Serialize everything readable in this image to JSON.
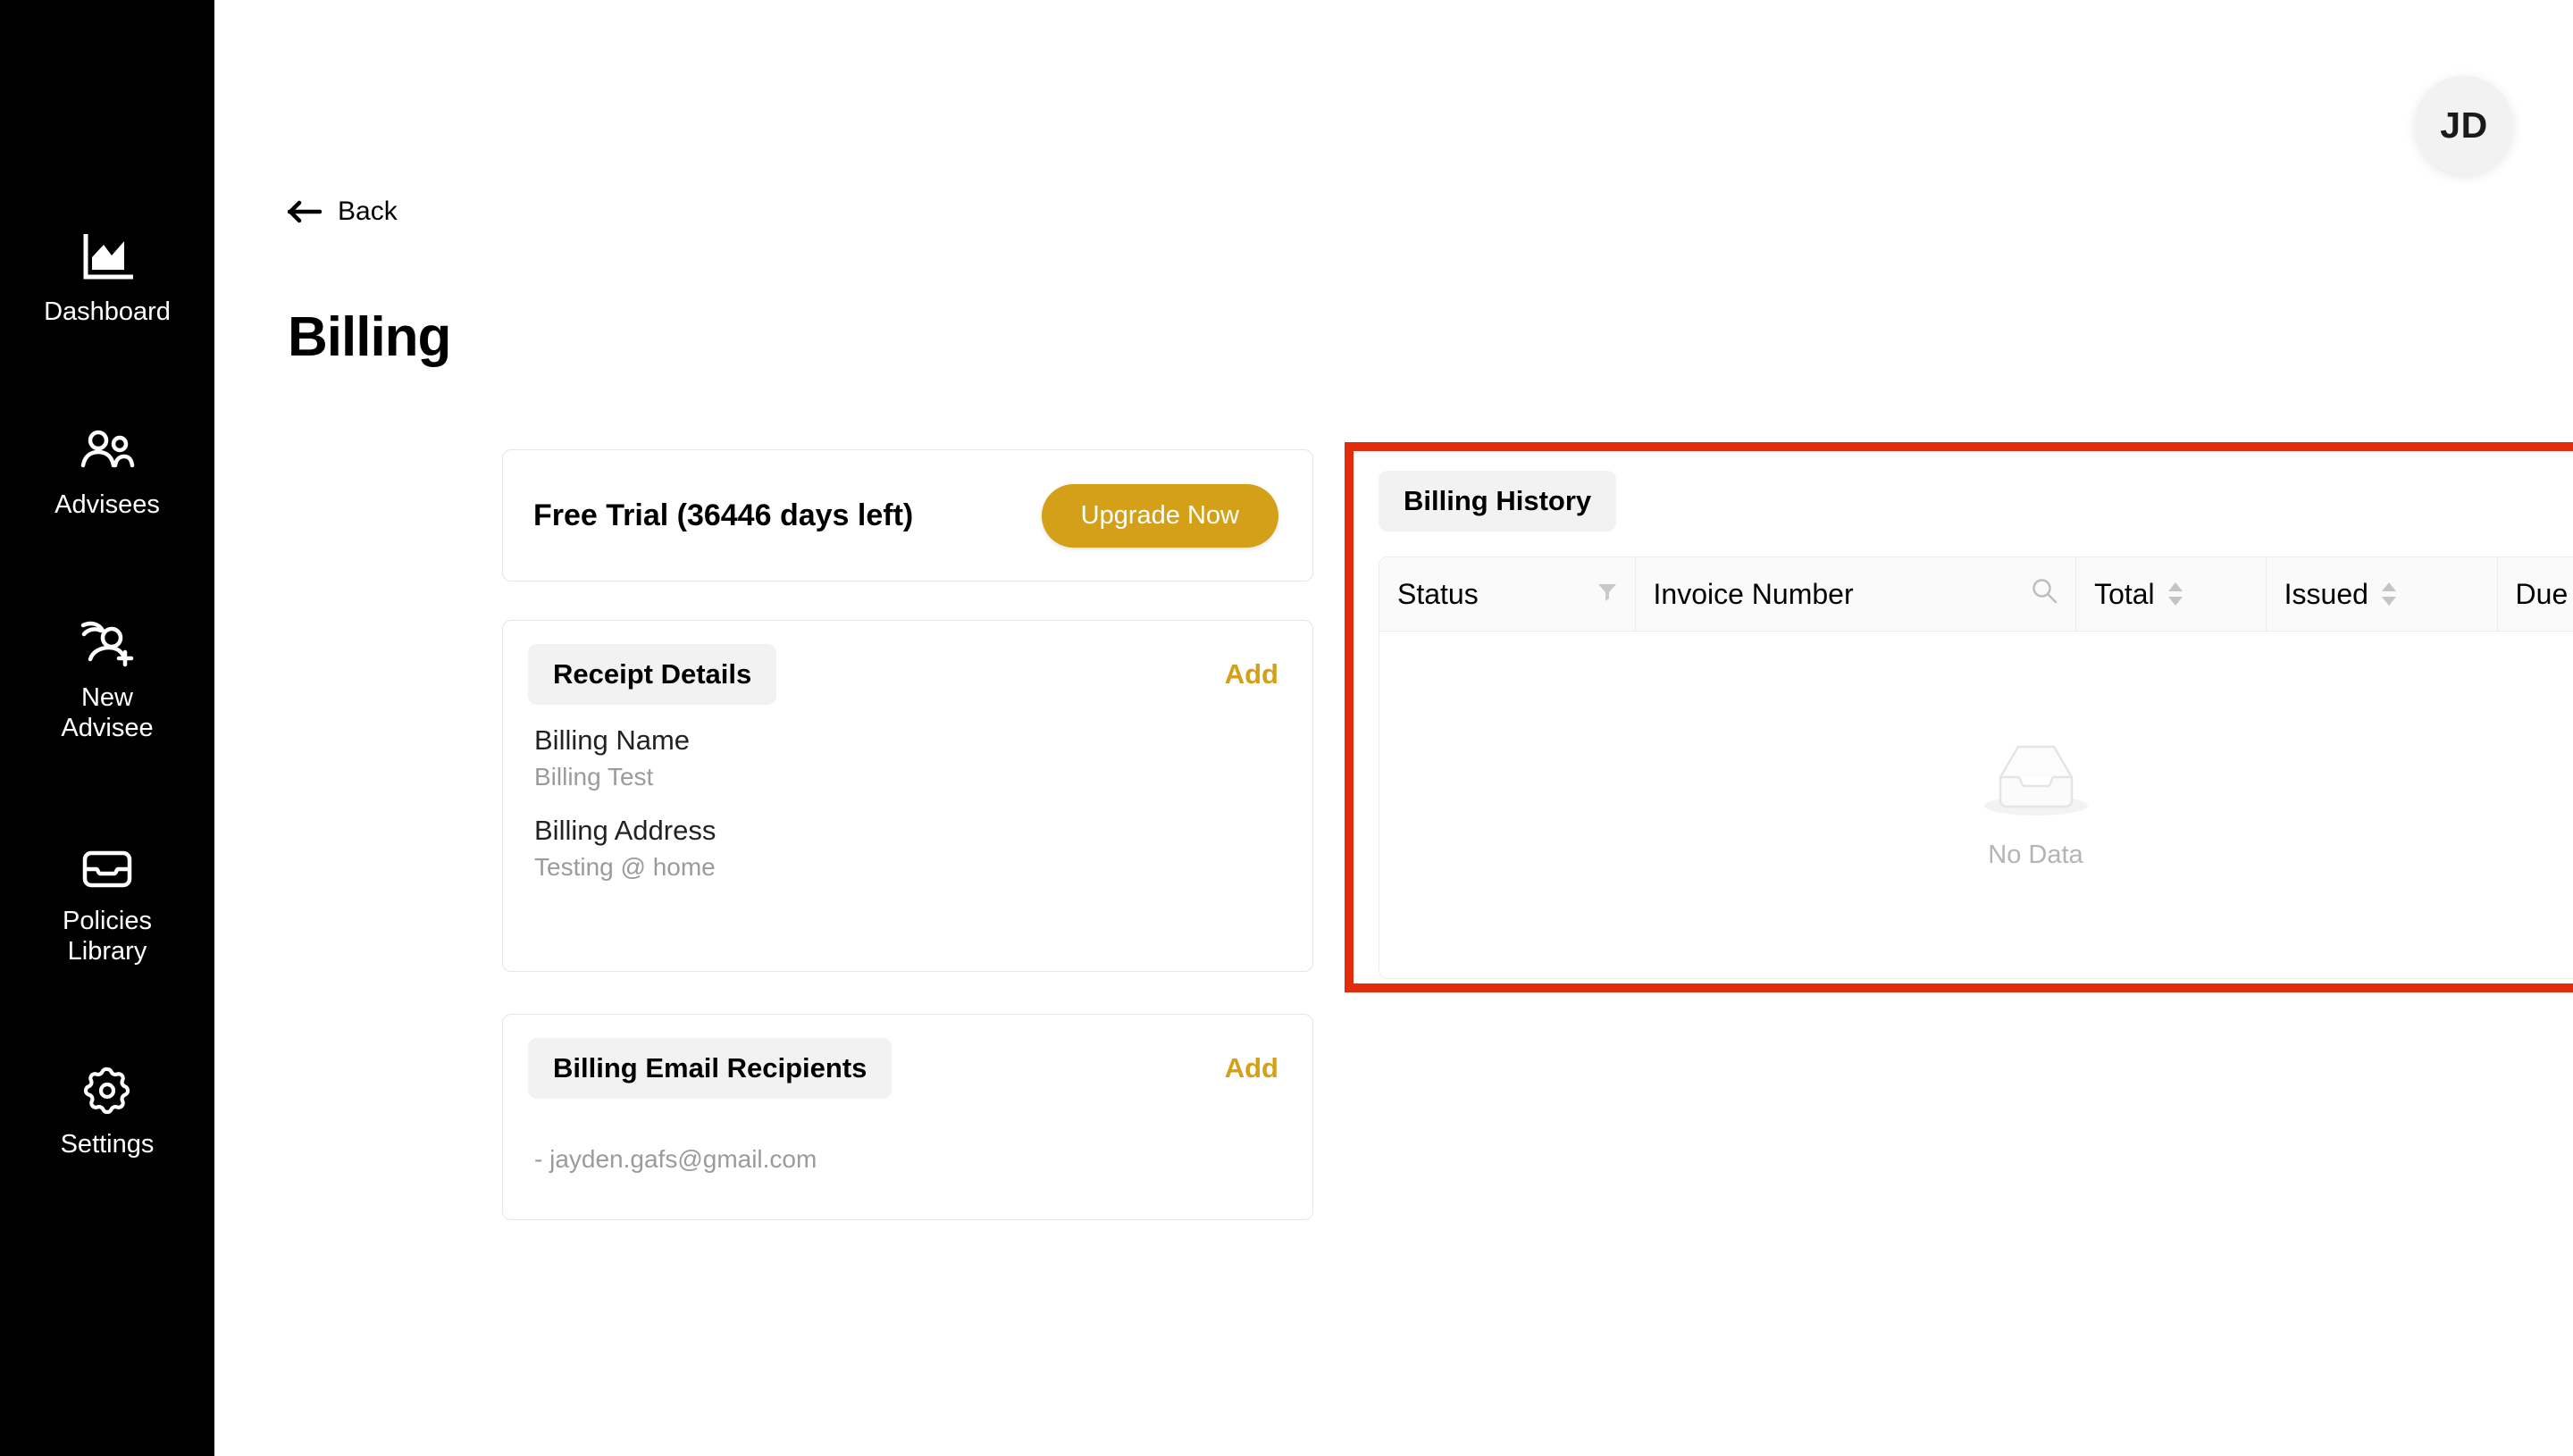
{
  "sidebar": {
    "background": "#000000",
    "items": [
      {
        "label": "Dashboard",
        "icon": "chart-area-icon"
      },
      {
        "label": "Advisees",
        "icon": "people-icon"
      },
      {
        "label": "New\nAdvisee",
        "icon": "person-add-icon"
      },
      {
        "label": "Policies\nLibrary",
        "icon": "inbox-icon"
      },
      {
        "label": "Settings",
        "icon": "gear-icon"
      }
    ]
  },
  "header": {
    "avatar_initials": "JD"
  },
  "nav": {
    "back_label": "Back",
    "back_icon": "arrow-left-icon"
  },
  "page": {
    "title": "Billing"
  },
  "trial": {
    "text": "Free Trial (36446 days left)",
    "upgrade_label": "Upgrade Now",
    "accent": "#d3a017"
  },
  "receipt": {
    "title": "Receipt Details",
    "add_label": "Add",
    "fields": [
      {
        "label": "Billing Name",
        "value": "Billing Test"
      },
      {
        "label": "Billing Address",
        "value": "Testing @ home"
      }
    ]
  },
  "emails": {
    "title": "Billing Email Recipients",
    "add_label": "Add",
    "recipients": [
      "- jayden.gafs@gmail.com"
    ]
  },
  "billing_history": {
    "title": "Billing History",
    "highlight_color": "#e22c0b",
    "columns": [
      {
        "label": "Status",
        "icon": "filter-icon"
      },
      {
        "label": "Invoice Number",
        "icon": "search-icon"
      },
      {
        "label": "Total",
        "icon": "sort-icon"
      },
      {
        "label": "Issued",
        "icon": "sort-icon"
      },
      {
        "label": "Due",
        "icon": "sort-icon"
      }
    ],
    "rows": [],
    "empty_text": "No Data",
    "empty_icon": "empty-box-icon"
  }
}
